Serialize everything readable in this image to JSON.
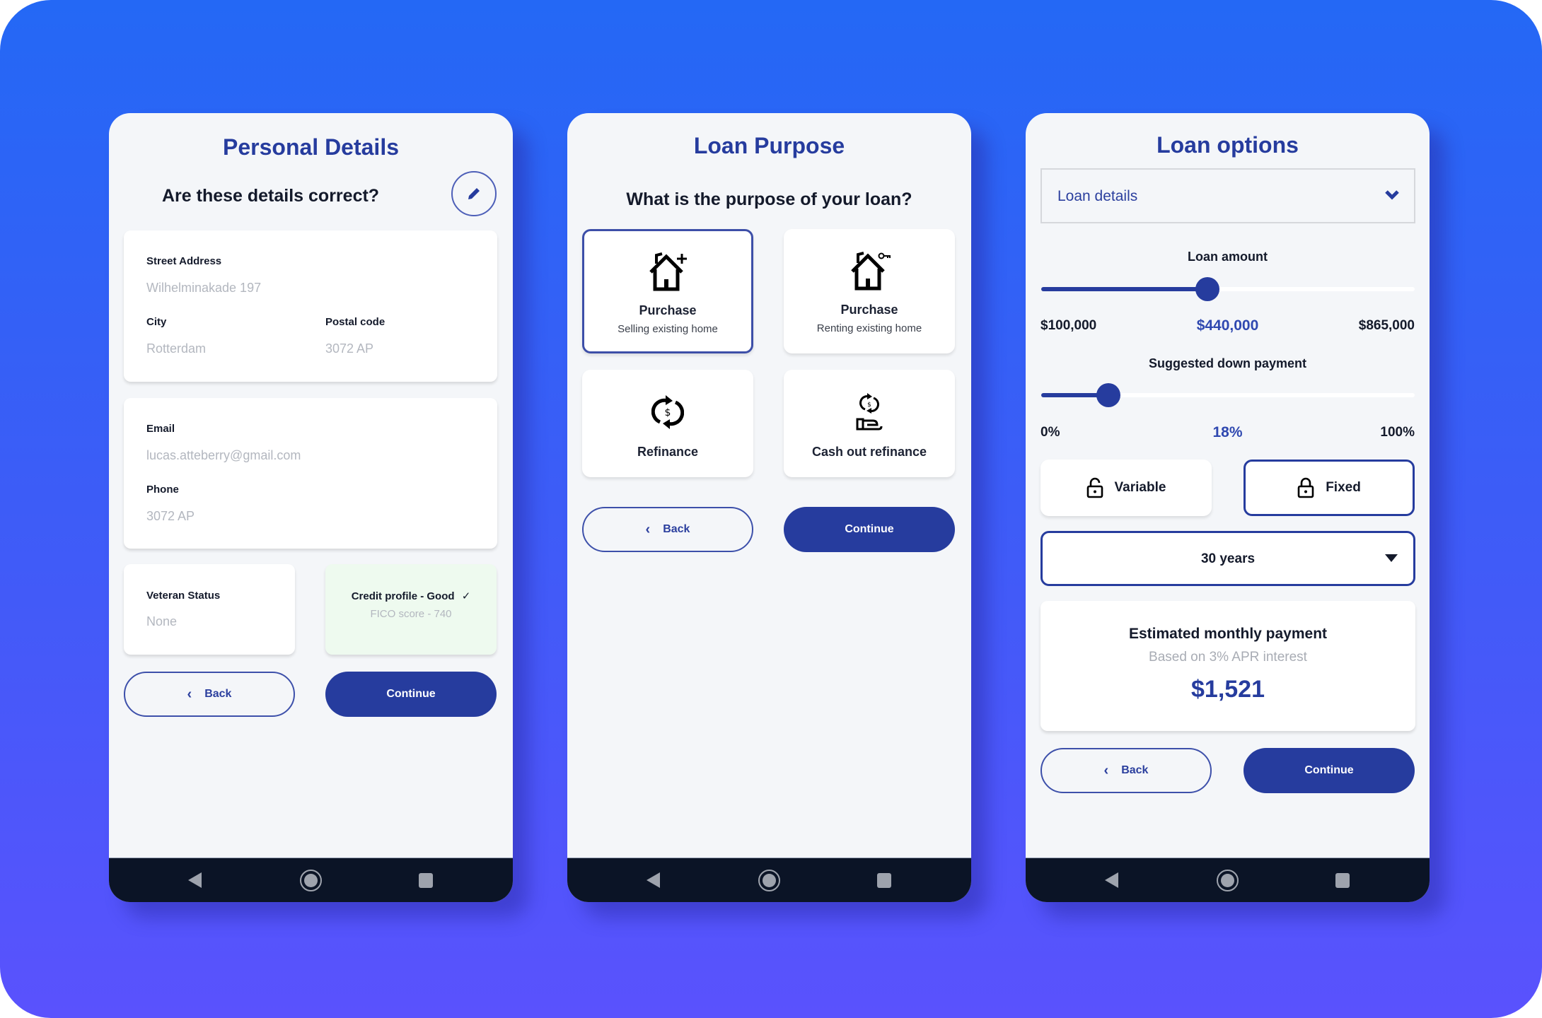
{
  "colors": {
    "primary": "#263c9e",
    "background_top": "#2468f5",
    "background_bottom": "#5a52fd",
    "screen_bg": "#f4f6f9",
    "navbar_bg": "#0b1426",
    "credit_card_bg": "#eefaef"
  },
  "phone1": {
    "title": "Personal Details",
    "question": "Are these details correct?",
    "edit_icon": "pencil-icon",
    "address_card": {
      "street_label": "Street Address",
      "street_value": "Wilhelminakade 197",
      "city_label": "City",
      "city_value": "Rotterdam",
      "postal_label": "Postal code",
      "postal_value": "3072 AP"
    },
    "contact_card": {
      "email_label": "Email",
      "email_value": "lucas.atteberry@gmail.com",
      "phone_label": "Phone",
      "phone_value": "3072 AP"
    },
    "veteran_card": {
      "label": "Veteran Status",
      "value": "None"
    },
    "credit_card": {
      "label": "Credit profile - Good",
      "check": "✓",
      "value": "FICO score - 740"
    },
    "back_label": "Back",
    "continue_label": "Continue"
  },
  "phone2": {
    "title": "Loan Purpose",
    "question": "What is the purpose of your loan?",
    "options": [
      {
        "icon": "house-plus-icon",
        "title": "Purchase",
        "subtitle": "Selling existing home",
        "selected": true
      },
      {
        "icon": "house-key-icon",
        "title": "Purchase",
        "subtitle": "Renting existing home",
        "selected": false
      },
      {
        "icon": "refinance-icon",
        "title": "Refinance",
        "subtitle": "",
        "selected": false
      },
      {
        "icon": "cash-out-icon",
        "title": "Cash out refinance",
        "subtitle": "",
        "selected": false
      }
    ],
    "back_label": "Back",
    "continue_label": "Continue"
  },
  "phone3": {
    "title": "Loan options",
    "accordion_label": "Loan details",
    "loan_amount": {
      "label": "Loan amount",
      "min_label": "$100,000",
      "value_label": "$440,000",
      "max_label": "$865,000",
      "min": 100000,
      "max": 865000,
      "value": 440000
    },
    "down_payment": {
      "label": "Suggested down payment",
      "min_label": "0%",
      "value_label": "18%",
      "max_label": "100%",
      "min": 0,
      "max": 100,
      "value": 18
    },
    "rate_types": [
      {
        "label": "Variable",
        "icon": "lock-open-icon",
        "selected": false
      },
      {
        "label": "Fixed",
        "icon": "lock-icon",
        "selected": true
      }
    ],
    "term_select": "30 years",
    "payment_card": {
      "title": "Estimated monthly payment",
      "subtitle": "Based on 3% APR interest",
      "amount": "$1,521"
    },
    "back_label": "Back",
    "continue_label": "Continue"
  }
}
